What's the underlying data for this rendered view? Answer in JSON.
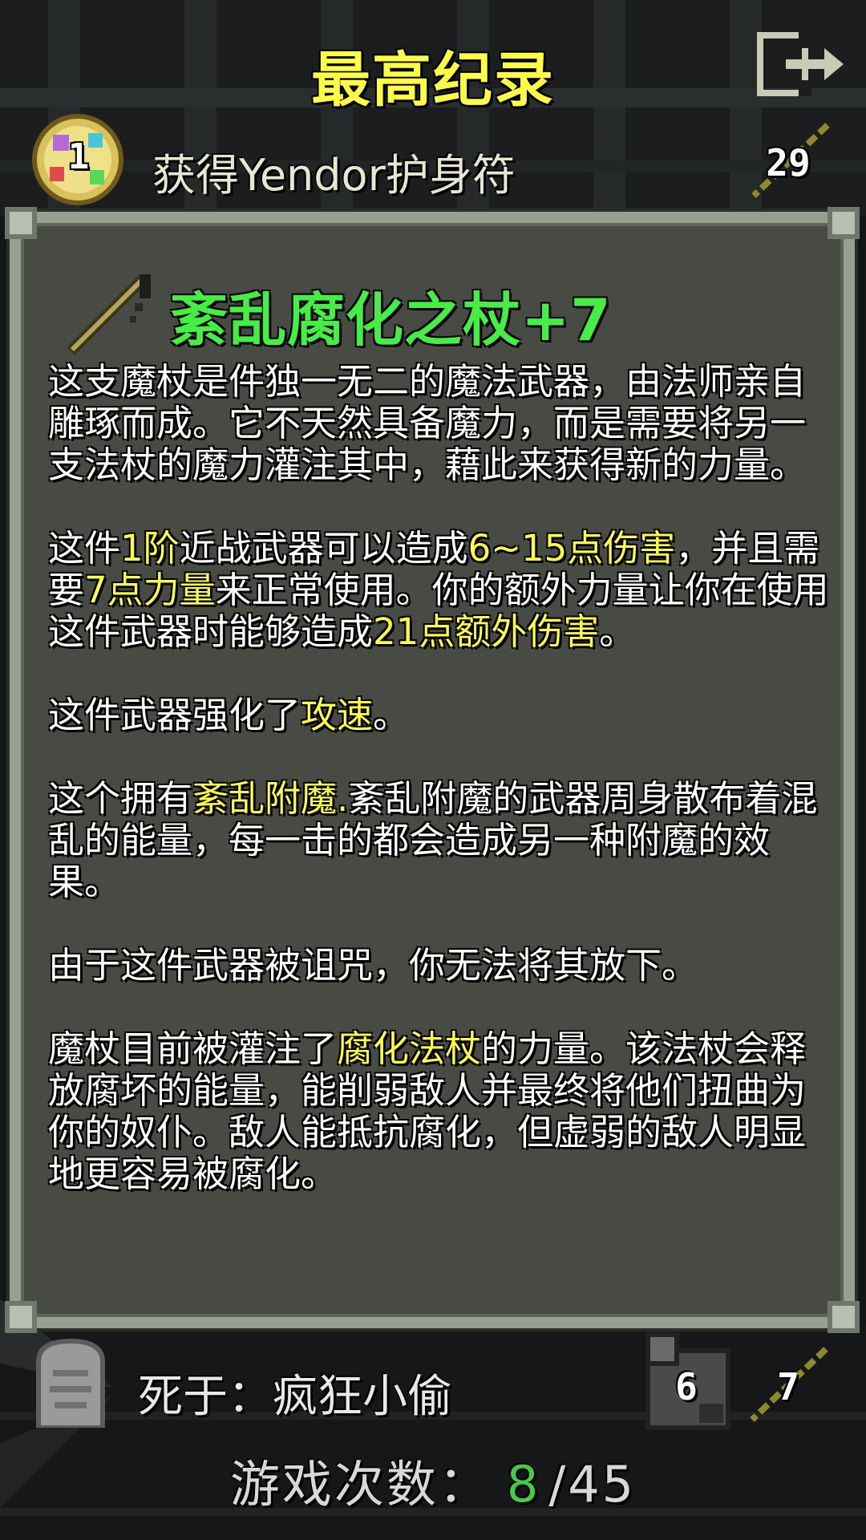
{
  "screen": {
    "title": "最高纪录",
    "exit_icon": "exit-door-icon"
  },
  "record": {
    "rank": "1",
    "description": "获得Yendor护身符",
    "depth": "29"
  },
  "item": {
    "name": "紊乱腐化之杖+7",
    "icon": "magic-staff-icon",
    "name_color": "#44ee44",
    "paragraphs": [
      [
        {
          "t": "这支魔杖是件独一无二的魔法武器，由法师亲自雕琢而成。它不天然具备魔力，而是需要将另一支法杖的魔力灌注其中，藉此来获得新的力量。"
        }
      ],
      [
        {
          "t": "这件"
        },
        {
          "t": "1阶",
          "hl": true
        },
        {
          "t": "近战武器可以造成"
        },
        {
          "t": "6~15点伤害",
          "hl": true
        },
        {
          "t": "，并且需要"
        },
        {
          "t": "7点力量",
          "hl": true
        },
        {
          "t": "来正常使用。你的额外力量让你在使用这件武器时能够造成"
        },
        {
          "t": "21点额外伤害",
          "hl": true
        },
        {
          "t": "。"
        }
      ],
      [
        {
          "t": "这件武器强化了"
        },
        {
          "t": "攻速",
          "hl": true
        },
        {
          "t": "。"
        }
      ],
      [
        {
          "t": "这个拥有"
        },
        {
          "t": "紊乱附魔.",
          "hl": true
        },
        {
          "t": "紊乱附魔的武器周身散布着混乱的能量，每一击的都会造成另一种附魔的效果。"
        }
      ],
      [
        {
          "t": "由于这件武器被诅咒，你无法将其放下。"
        }
      ],
      [
        {
          "t": "魔杖目前被灌注了"
        },
        {
          "t": "腐化法杖",
          "hl": true
        },
        {
          "t": "的力量。该法杖会释放腐坏的能量，能削弱敌人并最终将他们扭曲为你的奴仆。敌人能抵抗腐化，但虚弱的敌人明显地更容易被腐化。"
        }
      ]
    ],
    "highlight_color": "#ffff44"
  },
  "footer": {
    "death_label": "死于：",
    "killer": "疯狂小偷",
    "tomb_icon": "tombstone-icon",
    "hero_level": "6",
    "depth": "7",
    "games_label": "游戏次数：",
    "games_won": "8",
    "games_total": "/45"
  }
}
